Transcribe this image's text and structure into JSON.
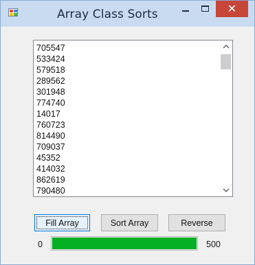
{
  "window": {
    "title": "Array Class Sorts",
    "close_glyph": "✕"
  },
  "list": {
    "items": [
      "705547",
      "533424",
      "579518",
      "289562",
      "301948",
      "774740",
      "14017",
      "760723",
      "814490",
      "709037",
      "45352",
      "414032",
      "862619",
      "790480"
    ],
    "scroll_up_icon": "chevron-up-icon",
    "scroll_down_icon": "chevron-down-icon"
  },
  "buttons": {
    "fill_label": "Fill Array",
    "sort_label": "Sort Array",
    "reverse_label": "Reverse"
  },
  "progress": {
    "min_label": "0",
    "max_label": "500",
    "value_fraction": 1.0
  },
  "colors": {
    "progress_fill": "#06b025",
    "close_button": "#c7463a",
    "titlebar": "#c9dbf1"
  }
}
